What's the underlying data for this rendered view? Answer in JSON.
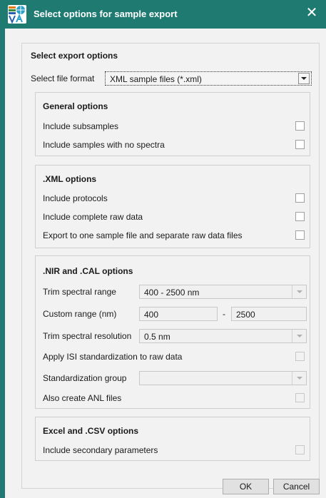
{
  "window": {
    "title": "Select options for sample export",
    "close_icon": "close-icon"
  },
  "export": {
    "heading": "Select export options",
    "file_format_label": "Select file format",
    "file_format_value": "XML sample files (*.xml)"
  },
  "general": {
    "heading": "General options",
    "include_subsamples": "Include subsamples",
    "include_no_spectra": "Include samples with no spectra"
  },
  "xml": {
    "heading": ".XML options",
    "include_protocols": "Include protocols",
    "include_raw": "Include complete raw data",
    "export_one_file": "Export to one sample file and separate raw data files"
  },
  "nir": {
    "heading": ".NIR and .CAL options",
    "trim_range_label": "Trim spectral range",
    "trim_range_value": "400 - 2500 nm",
    "custom_range_label": "Custom range (nm)",
    "custom_from": "400",
    "custom_dash": "-",
    "custom_to": "2500",
    "trim_res_label": "Trim spectral resolution",
    "trim_res_value": "0.5 nm",
    "apply_isi": "Apply ISI standardization to raw data",
    "std_group_label": "Standardization group",
    "std_group_value": "",
    "anl_files": "Also create ANL files"
  },
  "excel": {
    "heading": "Excel and .CSV options",
    "secondary": "Include secondary parameters"
  },
  "buttons": {
    "ok": "OK",
    "cancel": "Cancel"
  }
}
